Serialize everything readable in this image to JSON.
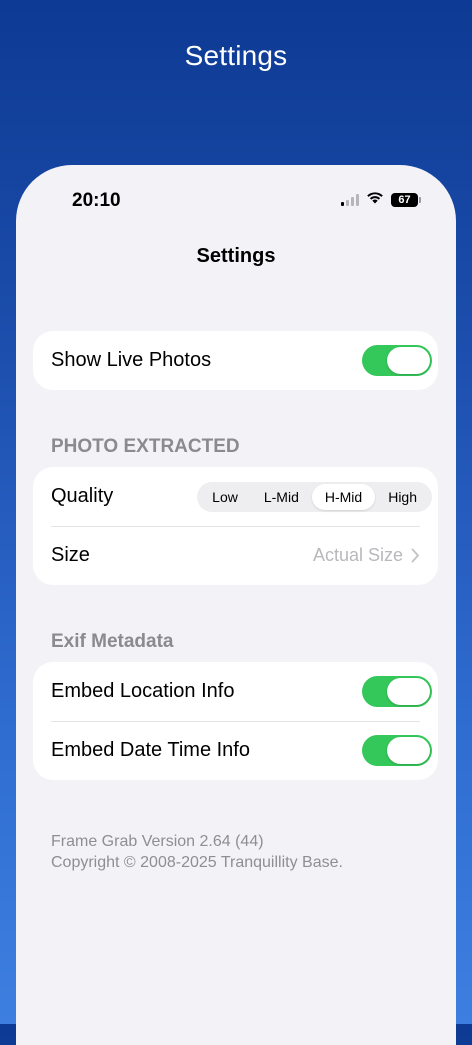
{
  "hero": {
    "title": "Settings"
  },
  "status_bar": {
    "time": "20:10",
    "battery": "67"
  },
  "nav": {
    "title": "Settings"
  },
  "live_photos": {
    "label": "Show Live Photos",
    "enabled": true
  },
  "photo_extracted": {
    "header": "PHOTO EXTRACTED",
    "quality_label": "Quality",
    "quality_options": [
      "Low",
      "L-Mid",
      "H-Mid",
      "High"
    ],
    "quality_selected": "H-Mid",
    "size_label": "Size",
    "size_value": "Actual Size"
  },
  "exif": {
    "header": "Exif Metadata",
    "location_label": "Embed Location Info",
    "location_enabled": true,
    "datetime_label": "Embed Date Time Info",
    "datetime_enabled": true
  },
  "footer": {
    "version": "Frame Grab Version 2.64 (44)",
    "copyright": "Copyright © 2008-2025 Tranquillity Base."
  },
  "colors": {
    "accent_green": "#34c759",
    "background_top": "#0d3a93",
    "background_bottom": "#3d7fe0"
  }
}
